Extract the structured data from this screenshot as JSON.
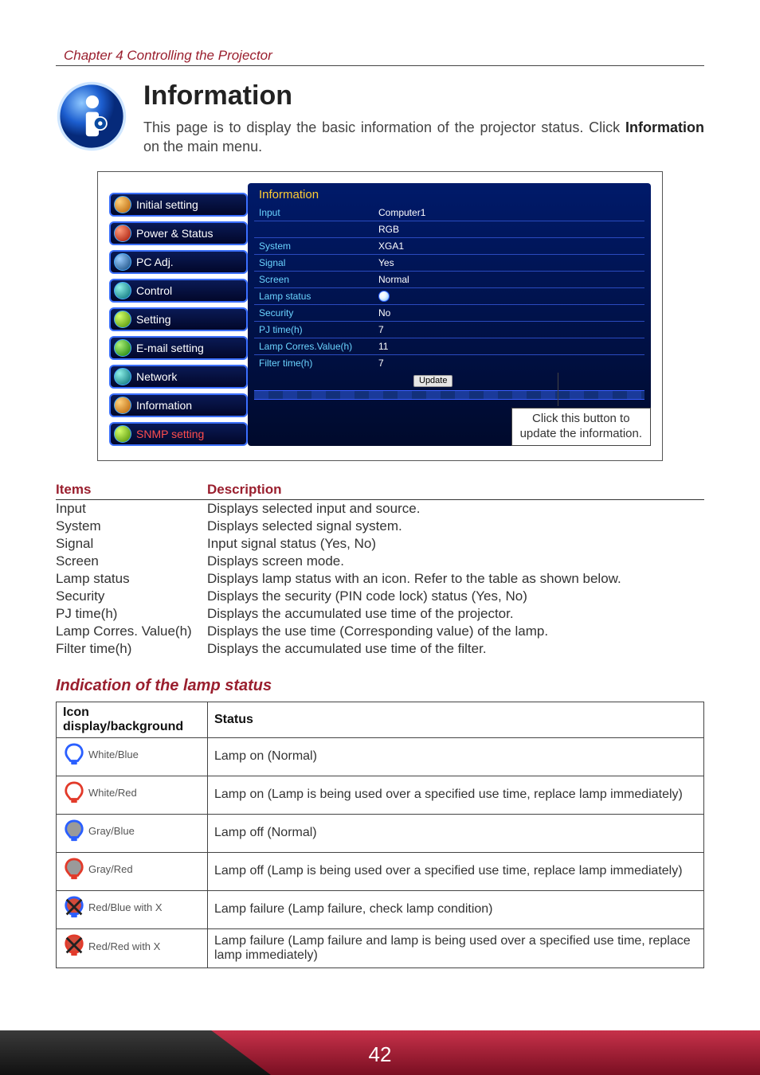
{
  "chapter": "Chapter 4 Controlling the Projector",
  "title": "Information",
  "intro_pre": "This page is to display the basic information of the projector status. Click ",
  "intro_bold": "Information",
  "intro_post": " on the main menu.",
  "sidebar": {
    "items": [
      {
        "label": "Initial setting",
        "icon": "orange"
      },
      {
        "label": "Power & Status",
        "icon": "red"
      },
      {
        "label": "PC Adj.",
        "icon": "blue"
      },
      {
        "label": "Control",
        "icon": "teal"
      },
      {
        "label": "Setting",
        "icon": "lime"
      },
      {
        "label": "E-mail setting",
        "icon": "green"
      },
      {
        "label": "Network",
        "icon": "teal"
      },
      {
        "label": "Information",
        "icon": "orange"
      },
      {
        "label": "SNMP setting",
        "icon": "lime",
        "red": true
      }
    ]
  },
  "panel": {
    "title": "Information",
    "rows": [
      {
        "k": "Input",
        "v": "Computer1"
      },
      {
        "k": "",
        "v": "RGB"
      },
      {
        "k": "System",
        "v": "XGA1"
      },
      {
        "k": "Signal",
        "v": "Yes"
      },
      {
        "k": "Screen",
        "v": "Normal"
      },
      {
        "k": "Lamp status",
        "v": "__LAMP_ICON__"
      },
      {
        "k": "Security",
        "v": "No"
      },
      {
        "k": "PJ time(h)",
        "v": "7"
      },
      {
        "k": "Lamp Corres.Value(h)",
        "v": "11"
      },
      {
        "k": "Filter time(h)",
        "v": "7"
      }
    ],
    "update": "Update"
  },
  "callout": {
    "line1": "Click this button to",
    "line2": "update the information."
  },
  "desc": {
    "head_items": "Items",
    "head_desc": "Description",
    "rows": [
      {
        "item": "Input",
        "desc": "Displays selected input and source."
      },
      {
        "item": "System",
        "desc": "Displays selected signal system."
      },
      {
        "item": "Signal",
        "desc": "Input signal status (Yes, No)"
      },
      {
        "item": "Screen",
        "desc": "Displays screen mode."
      },
      {
        "item": "Lamp status",
        "desc": "Displays lamp status with an icon. Refer to the table as shown below."
      },
      {
        "item": "Security",
        "desc": "Displays the security (PIN code lock) status (Yes, No)"
      },
      {
        "item": "PJ time(h)",
        "desc": "Displays the accumulated use time of the projector."
      },
      {
        "item": "Lamp Corres. Value(h)",
        "desc": "Displays the use time (Corresponding value) of the lamp."
      },
      {
        "item": "Filter time(h)",
        "desc": "Displays the accumulated use time of the filter."
      }
    ]
  },
  "lamp_heading": "Indication of the lamp status",
  "lamp_table": {
    "head_icon": "Icon display/background",
    "head_status": "Status",
    "rows": [
      {
        "label": "White/Blue",
        "bulb": "white",
        "bg": "blue",
        "x": false,
        "status": "Lamp on (Normal)"
      },
      {
        "label": "White/Red",
        "bulb": "white",
        "bg": "red",
        "x": false,
        "status": "Lamp on (Lamp is being used over a specified use time, replace lamp immediately)"
      },
      {
        "label": "Gray/Blue",
        "bulb": "gray",
        "bg": "blue",
        "x": false,
        "status": "Lamp off (Normal)"
      },
      {
        "label": "Gray/Red",
        "bulb": "gray",
        "bg": "red",
        "x": false,
        "status": "Lamp off (Lamp is being used over a specified use time, replace lamp immediately)"
      },
      {
        "label": "Red/Blue with X",
        "bulb": "red",
        "bg": "blue",
        "x": true,
        "status": "Lamp failure (Lamp failure, check lamp condition)"
      },
      {
        "label": "Red/Red with X",
        "bulb": "red",
        "bg": "red",
        "x": true,
        "status": "Lamp failure (Lamp failure and lamp is being used over a specified use time, replace lamp immediately)"
      }
    ]
  },
  "page_number": "42"
}
